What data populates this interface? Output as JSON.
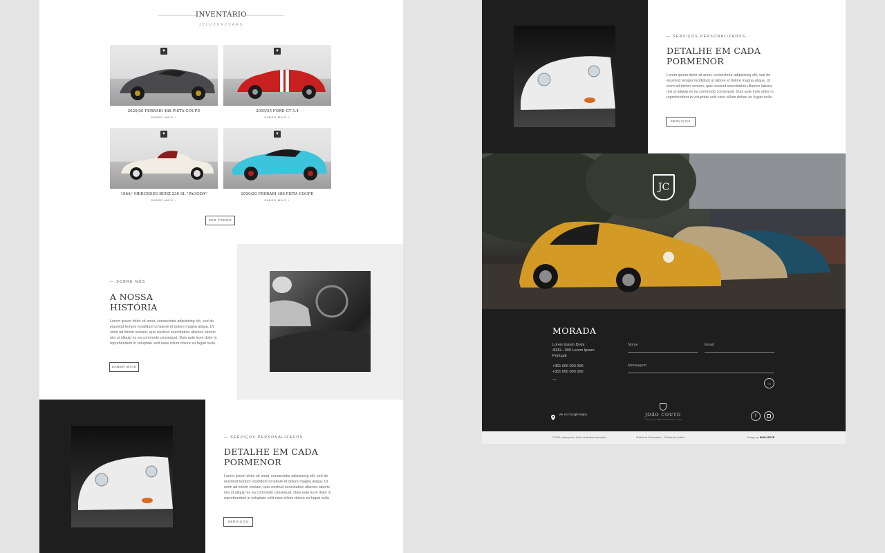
{
  "inventory": {
    "title": "INVENTÁRIO",
    "subtitle": "JCLUXURYCARS",
    "cars": [
      {
        "name": "2020/20 FERRARI 488 PISTA COUPE",
        "more": "SABER MAIS +",
        "color": "#4a4a4c"
      },
      {
        "name": "2005/55 FORD GT 5.4",
        "more": "SABER MAIS +",
        "color": "#c8201e"
      },
      {
        "name": "1964/- MERCEDES-BENZ 230 SL \"PAGODA\"",
        "more": "SABER MAIS +",
        "color": "#f1ede2"
      },
      {
        "name": "2020/20 FERRARI 488 PISTA COUPE",
        "more": "SABER MAIS +",
        "color": "#3cc4dc"
      }
    ],
    "view_all": "VER TODOS"
  },
  "about": {
    "label": "— SOBRE NÓS",
    "title_line1": "A NOSSA",
    "title_line2": "HISTÓRIA",
    "body": "Lorem ipsum dolor sit amet, consectetur adipisicing elit, sed do eiusmod tempor incididunt ut labore et dolore magna aliqua. Ut enim ad minim veniam, quis nostrud exercitation ullamco laboris nisi ut aliquip ex ea commodo consequat. Duis aute irure dolor in reprehenderit in voluptate velit esse cillum dolore eu fugiat nulla",
    "button": "SABER MAIS"
  },
  "services": {
    "label": "— SERVIÇOS PERSONALIZADOS",
    "title_line1": "DETALHE EM CADA",
    "title_line2": "PORMENOR",
    "body": "Lorem ipsum dolor sit amet, consectetur adipisicing elit, sed do eiusmod tempor incididunt ut labore et dolore magna aliqua. Ut enim ad minim veniam, quis nostrud exercitation ullamco laboris nisi ut aliquip ex ea commodo consequat. Duis aute irure dolor in reprehenderit in voluptate velit esse cillum dolore eu fugiat nulla",
    "button": "SERVIÇOS"
  },
  "hero": {
    "logo": "JC"
  },
  "contact": {
    "title": "MORADA",
    "address_line1": "Lorem Ipsum Dolor",
    "address_line2": "4000—000  Lorem Ipsum",
    "address_line3": "Portugal",
    "phone1": "+351 000 000 000",
    "phone2": "+351 000 000 000",
    "dash": "—",
    "name_placeholder": "Nome",
    "email_placeholder": "Email",
    "message_placeholder": "Mensagem",
    "maps_link": "Ver no Google Maps",
    "brand_name": "JOÃO COUTO",
    "brand_tagline": "LUXURY & PERFORMANCE CARS"
  },
  "footer": {
    "copyright": "© 2021 jcluxurycars | Todos os direitos reservados",
    "privacy": "Política de Privacidade",
    "separator": "|",
    "cookies": "Política de cookies",
    "design_by": "Design by:",
    "agency": "BULLSEYE"
  },
  "colors": {
    "dark": "#1e1e1e",
    "light_gray": "#efefef",
    "accent_white": "#ffffff"
  },
  "icons": [
    "pin-icon",
    "facebook-icon",
    "instagram-icon",
    "arrow-right-icon",
    "jc-logo-icon"
  ]
}
